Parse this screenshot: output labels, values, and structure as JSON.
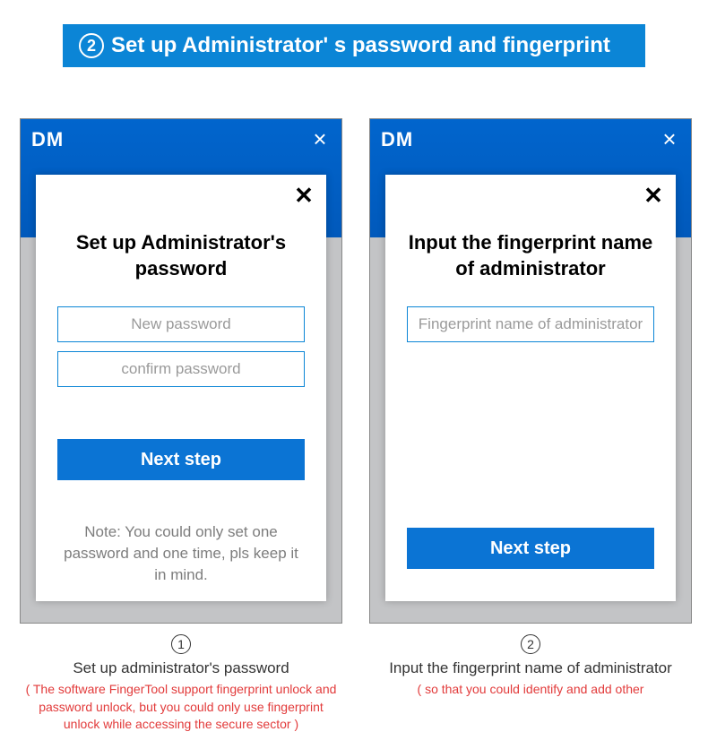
{
  "banner": {
    "number": "2",
    "text": "Set up  Administrator'  s  password and fingerprint"
  },
  "logo_text": "DM",
  "win_close_glyph": "×",
  "modal_close_glyph": "✕",
  "left": {
    "title": "Set up  Administrator's password",
    "field1_placeholder": "New password",
    "field2_placeholder": "confirm password",
    "next_label": "Next step",
    "note": "Note: You could only set one password and one time, pls keep it in mind."
  },
  "right": {
    "title": "Input the fingerprint name of administrator",
    "field_placeholder": "Fingerprint name of administrator",
    "next_label": "Next step"
  },
  "caption_left": {
    "num": "1",
    "main": "Set up  administrator's  password",
    "red": "( The software FingerTool support fingerprint unlock and password unlock, but you could only use fingerprint unlock while accessing the secure sector )"
  },
  "caption_right": {
    "num": "2",
    "main": "Input the  fingerprint name of administrator",
    "red": "( so that you could identify and add other"
  }
}
